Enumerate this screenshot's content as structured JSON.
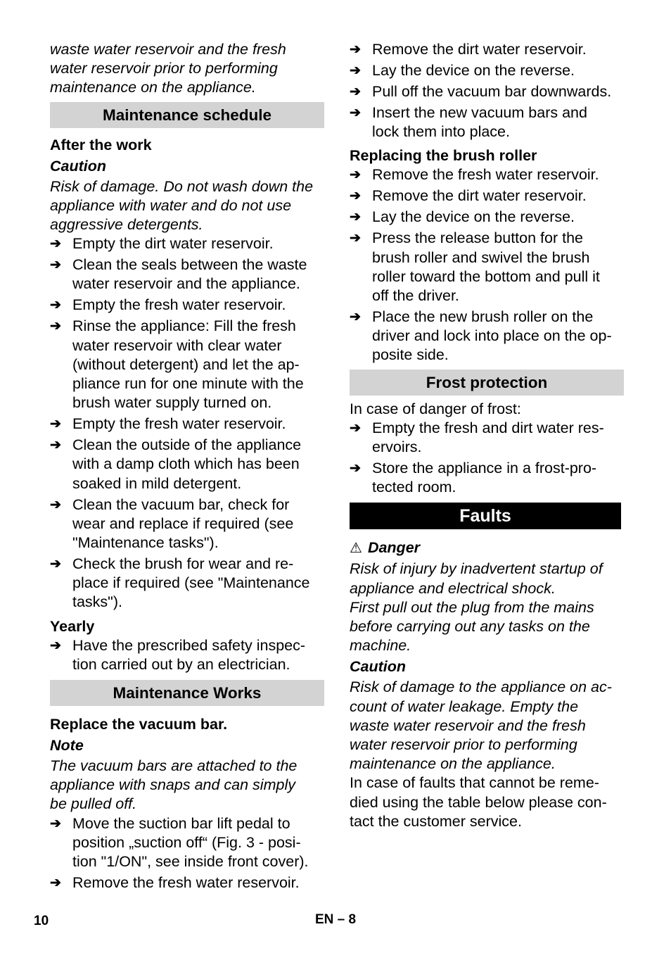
{
  "left_column": {
    "intro_lines": [
      "waste water reservoir and the fresh",
      "water reservoir prior to performing",
      "maintenance on the appliance."
    ],
    "maintenance_schedule": {
      "title": "Maintenance schedule",
      "after_work": {
        "heading": "After the work",
        "caution_label": "Caution",
        "caution_lines": [
          "Risk of damage. Do not wash down the",
          "appliance with water and do not use",
          "aggressive detergents."
        ],
        "steps": [
          {
            "lines": [
              "Empty the dirt water reservoir."
            ]
          },
          {
            "lines": [
              "Clean the seals between the waste",
              "water reservoir and the appliance."
            ]
          },
          {
            "lines": [
              "Empty the fresh water reservoir."
            ]
          },
          {
            "lines": [
              "Rinse the appliance: Fill the fresh",
              "water reservoir with clear water",
              "(without detergent) and let the ap-",
              "pliance run for one minute with the",
              "brush water supply turned on."
            ]
          },
          {
            "lines": [
              "Empty the fresh water reservoir."
            ]
          },
          {
            "lines": [
              "Clean the outside of the appliance",
              "with a damp cloth which has been",
              "soaked in mild detergent."
            ]
          },
          {
            "lines": [
              "Clean the vacuum bar, check for",
              "wear and replace if required (see",
              "\"Maintenance tasks\")."
            ]
          },
          {
            "lines": [
              "Check the brush for wear and re-",
              "place if required (see \"Maintenance",
              "tasks\")."
            ]
          }
        ]
      },
      "yearly": {
        "heading": "Yearly",
        "steps": [
          {
            "lines": [
              "Have the prescribed safety inspec-",
              "tion carried out by an electrician."
            ]
          }
        ]
      }
    },
    "maintenance_works": {
      "title": "Maintenance Works",
      "replace_vacuum_bar": {
        "heading": "Replace the vacuum bar.",
        "note_label": "Note",
        "note_lines": [
          "The vacuum bars are attached to the",
          "appliance with snaps and can simply",
          "be pulled off."
        ],
        "steps": [
          {
            "lines": [
              "Move the suction bar lift pedal to",
              "position „suction off“ (Fig. 3 - posi-",
              "tion \"1/ON\", see inside front cover)."
            ]
          },
          {
            "lines": [
              "Remove the fresh water reservoir."
            ]
          }
        ]
      }
    }
  },
  "right_column": {
    "vacuum_bar_steps_cont": [
      {
        "lines": [
          "Remove the dirt water reservoir."
        ]
      },
      {
        "lines": [
          "Lay the device on the reverse."
        ]
      },
      {
        "lines": [
          "Pull off the vacuum bar downwards."
        ]
      },
      {
        "lines": [
          "Insert the new vacuum bars and",
          "lock them into place."
        ]
      }
    ],
    "brush_roller": {
      "heading": "Replacing the brush roller",
      "steps": [
        {
          "lines": [
            "Remove the fresh water reservoir."
          ]
        },
        {
          "lines": [
            "Remove the dirt water reservoir."
          ]
        },
        {
          "lines": [
            "Lay the device on the reverse."
          ]
        },
        {
          "lines": [
            "Press the release button for the",
            "brush roller and swivel the brush",
            "roller toward the bottom and pull it",
            "off the driver."
          ]
        },
        {
          "lines": [
            "Place the new brush roller on the",
            "driver and lock into place on the op-",
            "posite side."
          ]
        }
      ]
    },
    "frost_protection": {
      "title": "Frost protection",
      "intro": "In case of danger of frost:",
      "steps": [
        {
          "lines": [
            "Empty the fresh and dirt water res-",
            "ervoirs."
          ]
        },
        {
          "lines": [
            "Store the appliance in a frost-pro-",
            "tected room."
          ]
        }
      ]
    },
    "faults": {
      "title": "Faults",
      "danger_icon": "⚠",
      "danger_label": "Danger",
      "danger_lines": [
        "Risk of injury by inadvertent startup of",
        "appliance and electrical shock.",
        "First pull out the plug from the mains",
        "before carrying out any tasks on the",
        "machine."
      ],
      "caution_label": "Caution",
      "caution_lines": [
        "Risk of damage to the appliance on ac-",
        "count of water leakage. Empty the",
        "waste water reservoir and the fresh",
        "water reservoir prior to performing",
        "maintenance on the appliance."
      ],
      "service_lines": [
        "In case of faults that cannot be reme-",
        "died using the table below please con-",
        "tact the customer service."
      ]
    }
  },
  "footer": {
    "page_number": "10",
    "language_page": "EN – 8"
  },
  "bullet_glyph": "➔"
}
